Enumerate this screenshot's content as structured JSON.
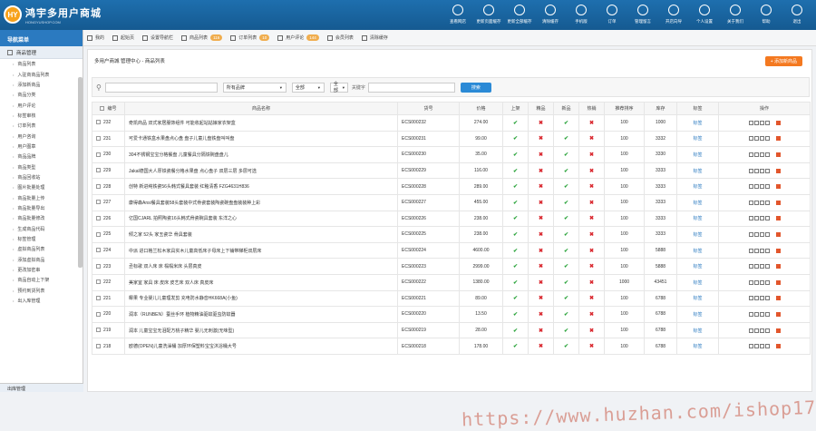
{
  "brand": {
    "badge": "HY",
    "title": "鸿宇多用户商城",
    "sub": "HONGYUSHOP.COM"
  },
  "topnav": [
    "查看网店",
    "更新页面缓存",
    "更新全部缓存",
    "清除缓存",
    "手机版",
    "订单",
    "管理留言",
    "开店向导",
    "个人设置",
    "关于我们",
    "帮助",
    "退出"
  ],
  "sidebar": {
    "header": "导航菜单",
    "group": "商品管理",
    "items": [
      "商品列表",
      "入驻商商品列表",
      "添加新商品",
      "商品分类",
      "用户评论",
      "标签审核",
      "订单列表",
      "用户咨询",
      "用户图章",
      "商品品牌",
      "商品类型",
      "商品回收站",
      "图片批量处理",
      "商品批量上传",
      "商品批量导出",
      "商品批量修改",
      "生成商品代码",
      "标签管理",
      "虚拟商品列表",
      "添加虚拟商品",
      "更改加密串",
      "商品自动上下架",
      "预约到货列表",
      "出入库管理"
    ],
    "bottom": "出库管理"
  },
  "tabs": [
    {
      "label": "我的",
      "badge": ""
    },
    {
      "label": "起始页",
      "badge": ""
    },
    {
      "label": "设置导航栏",
      "badge": ""
    },
    {
      "label": "商品列表",
      "badge": "116"
    },
    {
      "label": "订单列表",
      "badge": "10"
    },
    {
      "label": "用户评论",
      "badge": "144"
    },
    {
      "label": "会员列表",
      "badge": ""
    },
    {
      "label": "清除缓存",
      "badge": ""
    }
  ],
  "main": {
    "breadcrumb": "多用户商城 管理中心 - 商品列表",
    "add_button": "+ 添加新商品",
    "search": {
      "category_value": "",
      "brand": "所有品牌",
      "filter1": "全部",
      "filter2": "全部",
      "keyword_label": "关键字",
      "keyword_value": "",
      "button": "搜索"
    },
    "columns": [
      "编号",
      "商品名称",
      "货号",
      "价格",
      "上架",
      "精品",
      "新品",
      "热销",
      "推荐排序",
      "库存",
      "标签",
      "操作"
    ],
    "rows": [
      {
        "id": "232",
        "name": "奇凯商品 双式家居服饰组件 可能收起站姑娘家衣架盒",
        "sn": "ECS000232",
        "price": "274.00",
        "on": 1,
        "best": 0,
        "new": 1,
        "hot": 0,
        "sort": "100",
        "stock": "1000",
        "tag": "标签"
      },
      {
        "id": "231",
        "name": "可爱卡通铁盒水果盘点心盘 盘子儿童儿盘铁盘叫叫盘",
        "sn": "ECS000231",
        "price": "99.00",
        "on": 1,
        "best": 0,
        "new": 1,
        "hot": 0,
        "sort": "100",
        "stock": "3332",
        "tag": "标签"
      },
      {
        "id": "230",
        "name": "304不锈钢宝宝分格餐盘 儿童餐具分隔铁碗盘盘儿",
        "sn": "ECS000230",
        "price": "35.00",
        "on": 1,
        "best": 0,
        "new": 1,
        "hot": 0,
        "sort": "100",
        "stock": "3330",
        "tag": "标签"
      },
      {
        "id": "229",
        "name": "Jakal德国大人厚铁瓷餐分格水果盘 点心盘子 双层三层 多层可选",
        "sn": "ECS000229",
        "price": "116.00",
        "on": 1,
        "best": 0,
        "new": 1,
        "hot": 0,
        "sort": "100",
        "stock": "3333",
        "tag": "标签"
      },
      {
        "id": "228",
        "name": "创特 新进纯铁瓷56头韩式餐具套装 红釉清香 FZG4631H836",
        "sn": "ECS000228",
        "price": "289.00",
        "on": 1,
        "best": 0,
        "new": 1,
        "hot": 0,
        "sort": "100",
        "stock": "3333",
        "tag": "标签"
      },
      {
        "id": "227",
        "name": "康得森Ansi餐具套装58头套装中式骨瓷套装陶瓷碗盘盘装装种上彩",
        "sn": "ECS000227",
        "price": "455.00",
        "on": 1,
        "best": 0,
        "new": 1,
        "hot": 0,
        "sort": "100",
        "stock": "3333",
        "tag": "标签"
      },
      {
        "id": "226",
        "name": "亿国CJARL 拍照陶瓷16头韩式骨瓷碗具套装 东洋之心",
        "sn": "ECS000226",
        "price": "238.00",
        "on": 1,
        "best": 0,
        "new": 1,
        "hot": 0,
        "sort": "100",
        "stock": "3333",
        "tag": "标签"
      },
      {
        "id": "225",
        "name": "倾之家 52头 家玉瓷华 骨具套装",
        "sn": "ECS000225",
        "price": "238.00",
        "on": 1,
        "best": 0,
        "new": 1,
        "hot": 0,
        "sort": "100",
        "stock": "3333",
        "tag": "标签"
      },
      {
        "id": "224",
        "name": "中派 进口格兰松木家具实木儿童高低床子母床上下铺带梯柜双层床",
        "sn": "ECS000224",
        "price": "4600.00",
        "on": 1,
        "best": 0,
        "new": 1,
        "hot": 0,
        "sort": "100",
        "stock": "5888",
        "tag": "标签"
      },
      {
        "id": "223",
        "name": "丞标歌 双人床 床 榻榻米床 头层真皮",
        "sn": "ECS000223",
        "price": "2999.00",
        "on": 1,
        "best": 0,
        "new": 1,
        "hot": 0,
        "sort": "100",
        "stock": "5888",
        "tag": "标签"
      },
      {
        "id": "222",
        "name": "美家宜 家具 床 皮床 皮艺床 双人床 真皮床",
        "sn": "ECS000222",
        "price": "1380.00",
        "on": 1,
        "best": 0,
        "new": 1,
        "hot": 0,
        "sort": "1000",
        "stock": "43451",
        "tag": "标签"
      },
      {
        "id": "221",
        "name": "椰果 专业婴儿儿童理发剪 充电防水静音HK668A(小鱼)",
        "sn": "ECS000221",
        "price": "89.00",
        "on": 1,
        "best": 0,
        "new": 1,
        "hot": 0,
        "sort": "100",
        "stock": "6788",
        "tag": "标签"
      },
      {
        "id": "220",
        "name": "润本（RUNBEN）蚕丝手环 植物精油驱蚊驱虫防蚊器",
        "sn": "ECS000220",
        "price": "13.50",
        "on": 1,
        "best": 0,
        "new": 1,
        "hot": 0,
        "sort": "100",
        "stock": "6788",
        "tag": "标签"
      },
      {
        "id": "219",
        "name": "润本 儿童宝宝无泪配方桃子精华 婴儿无刺激(无味型)",
        "sn": "ECS000219",
        "price": "28.00",
        "on": 1,
        "best": 0,
        "new": 1,
        "hot": 0,
        "sort": "100",
        "stock": "6788",
        "tag": "标签"
      },
      {
        "id": "218",
        "name": "欧德(OPEN)儿童洗澡桶 加厚环保塑料宝宝沐浴桶大号",
        "sn": "ECS000218",
        "price": "178.00",
        "on": 1,
        "best": 0,
        "new": 1,
        "hot": 0,
        "sort": "100",
        "stock": "6788",
        "tag": "标签"
      }
    ]
  },
  "watermark": "https://www.huzhan.com/ishop17677",
  "colors": {
    "topbar": "#1e6fae",
    "accent": "#f47920",
    "ok": "#2aa33a",
    "no": "#d9272e",
    "button": "#2b8ad6"
  }
}
